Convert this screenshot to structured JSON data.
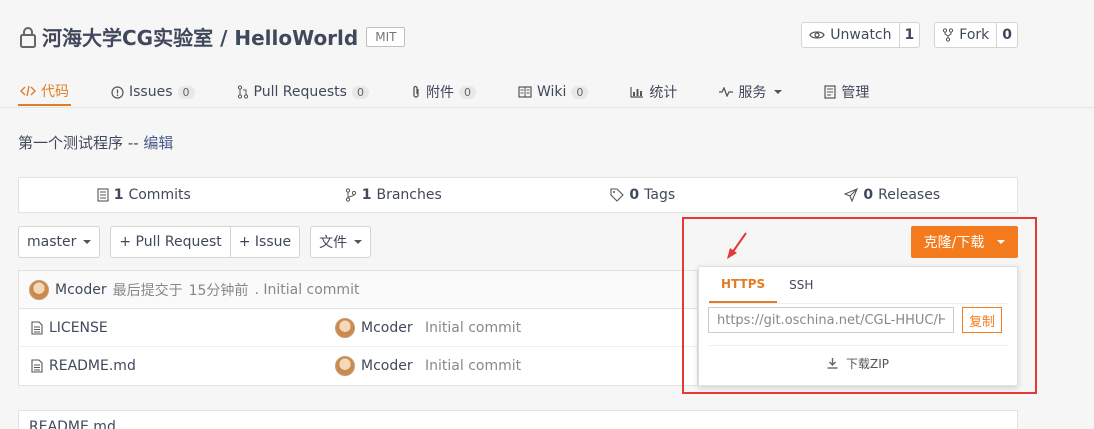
{
  "repo": {
    "owner": "河海大学CG实验室",
    "separator": "/",
    "name": "HelloWorld",
    "license": "MIT",
    "description": "第一个测试程序",
    "desc_sep": "--",
    "edit_label": "编辑"
  },
  "actions": {
    "watch_label": "Unwatch",
    "watch_count": "1",
    "fork_label": "Fork",
    "fork_count": "0"
  },
  "tabs": [
    {
      "label": "代码",
      "icon": "code-icon",
      "active": true
    },
    {
      "label": "Issues",
      "count": "0",
      "icon": "issue-icon"
    },
    {
      "label": "Pull Requests",
      "count": "0",
      "icon": "pull-request-icon"
    },
    {
      "label": "附件",
      "count": "0",
      "icon": "attachment-icon"
    },
    {
      "label": "Wiki",
      "count": "0",
      "icon": "wiki-icon"
    },
    {
      "label": "统计",
      "icon": "stats-icon"
    },
    {
      "label": "服务",
      "icon": "service-icon"
    },
    {
      "label": "管理",
      "icon": "manage-icon"
    }
  ],
  "stats": {
    "commits_count": "1",
    "commits_label": "Commits",
    "branches_count": "1",
    "branches_label": "Branches",
    "tags_count": "0",
    "tags_label": "Tags",
    "releases_count": "0",
    "releases_label": "Releases"
  },
  "toolbar": {
    "branch": "master",
    "pull_request": "+ Pull Request",
    "issue": "+ Issue",
    "file_menu": "文件"
  },
  "last_commit": {
    "author": "Mcoder",
    "prefix": "最后提交于",
    "time": "15分钟前",
    "message": ". Initial commit"
  },
  "files": [
    {
      "name": "LICENSE",
      "author": "Mcoder",
      "message": "Initial commit"
    },
    {
      "name": "README.md",
      "author": "Mcoder",
      "message": "Initial commit"
    }
  ],
  "clone": {
    "button_label": "克隆/下载",
    "tab_https": "HTTPS",
    "tab_ssh": "SSH",
    "url": "https://git.oschina.net/CGL-HHUC/HelloWorld.git",
    "copy_label": "复制",
    "zip_label": "下载ZIP"
  },
  "readme": {
    "label": "README.md"
  },
  "colors": {
    "accent": "#f37b1d",
    "highlight": "#e53935"
  }
}
